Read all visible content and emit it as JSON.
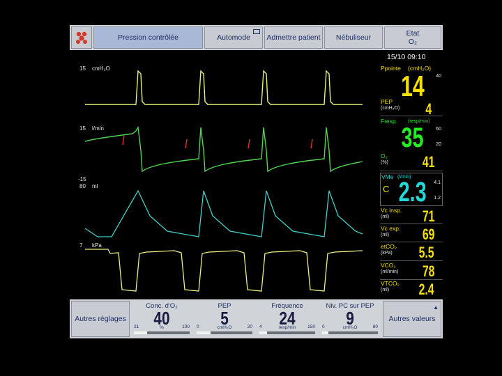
{
  "toolbar": {
    "mode": "Pression contrôlée",
    "automode": "Automode",
    "admit": "Admettre patient",
    "nebulizer": "Nébuliseur",
    "status_line1": "Etat",
    "status_line2": "O₂"
  },
  "datetime": "15/10   09:10",
  "waveforms": [
    {
      "scale": "15",
      "unit": "cmH₂O",
      "color": "#e8f07a"
    },
    {
      "scale": "15",
      "unit": "l/min",
      "color": "#4fd64f"
    },
    {
      "scale": "-15",
      "scale2": "80",
      "unit": "ml",
      "color": "#3fd0c8"
    },
    {
      "scale": "7",
      "unit": "kPa",
      "color": "#f0f080"
    }
  ],
  "params": {
    "ppeak": {
      "label": "Ppointe",
      "unit": "(cmH₂O)",
      "value": "14",
      "lim_hi": "40",
      "color": "#f5e000"
    },
    "peep": {
      "label": "PEP",
      "unit": "(cmH₂O)",
      "value": "4",
      "color": "#f5e000"
    },
    "rr": {
      "label": "Fresp.",
      "unit": "(resp/min)",
      "value": "35",
      "lim_hi": "60",
      "lim_lo": "20",
      "color": "#22ee22"
    },
    "o2": {
      "label": "O₂",
      "unit": "(%)",
      "value": "41",
      "color": "#f5e000"
    },
    "mv": {
      "label": "VMe",
      "unit": "(l/min)",
      "value": "2.3",
      "prefix": "C",
      "lim_hi": "4.1",
      "lim_lo": "1.2",
      "color": "#22d8d8"
    },
    "vti": {
      "label": "Vc insp.",
      "unit": "(ml)",
      "value": "71",
      "color": "#f5e000"
    },
    "vte": {
      "label": "Vc exp.",
      "unit": "(ml)",
      "value": "69",
      "color": "#f5e000"
    },
    "etco2": {
      "label": "etCO₂",
      "unit": "(kPa)",
      "value": "5.5",
      "color": "#f5e000"
    },
    "vco2": {
      "label": "VCO₂",
      "unit": "(ml/min)",
      "value": "78",
      "color": "#f5e000"
    },
    "vtco2": {
      "label": "VTCO₂",
      "unit": "(ml)",
      "value": "2.4",
      "color": "#f5e000"
    }
  },
  "bottom": {
    "other_settings": "Autres réglages",
    "other_values": "Autres valeurs",
    "controls": [
      {
        "title": "Conc. d'O₂",
        "value": "40",
        "min": "21",
        "max": "100",
        "unit": "%",
        "level": 0.24
      },
      {
        "title": "PEP",
        "value": "5",
        "min": "0",
        "max": "20",
        "unit": "cmH₂O",
        "level": 0.25
      },
      {
        "title": "Fréquence",
        "value": "24",
        "min": "4",
        "max": "150",
        "unit": "resp/min",
        "level": 0.14
      },
      {
        "title": "Niv. PC sur PEP",
        "value": "9",
        "min": "0",
        "max": "80",
        "unit": "cmH₂O",
        "level": 0.11
      }
    ]
  }
}
